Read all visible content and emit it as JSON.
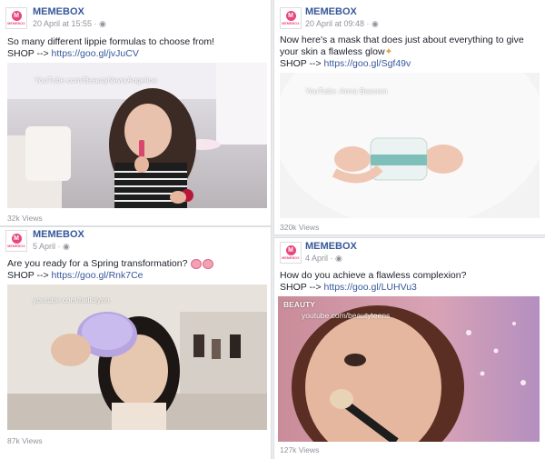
{
  "posts": [
    {
      "page_name": "MEMEBOX",
      "date": "20 April at 15:55 · ",
      "text": "So many different lippie formulas to choose from!",
      "shop_prefix": "SHOP --> ",
      "link": "https://goo.gl/jvJuCV",
      "watermark": "YouTube.com/BeautyNewsAngelica",
      "views": "32k Views"
    },
    {
      "page_name": "MEMEBOX",
      "date": "20 April at 09:48 · ",
      "text": "Now here's a mask that does just about everything to give your skin a flawless glow",
      "shop_prefix": "SHOP --> ",
      "link": "https://goo.gl/Sgf49v",
      "watermark": "YouTube: Anna Bascom",
      "views": "320k Views"
    },
    {
      "page_name": "MEMEBOX",
      "date": "5 April · ",
      "text": "Are you ready for a Spring transformation?",
      "shop_prefix": "SHOP --> ",
      "link": "https://goo.gl/Rnk7Ce",
      "watermark": "youtube.com/hellolynn",
      "views": "87k Views"
    },
    {
      "page_name": "MEMEBOX",
      "date": "4 April · ",
      "text": "How do you achieve a flawless complexion?",
      "shop_prefix": "SHOP --> ",
      "link": "https://goo.gl/LUHVu3",
      "watermark": "youtube.com/beautyteens",
      "brand_overlay": "BEAUTY",
      "views": "127k Views"
    }
  ],
  "avatar": {
    "logo_text": "MEMEBOX",
    "brand_color": "#e8467c"
  },
  "colors": {
    "link": "#365899",
    "meta": "#90949c",
    "background": "#e9ebee"
  }
}
